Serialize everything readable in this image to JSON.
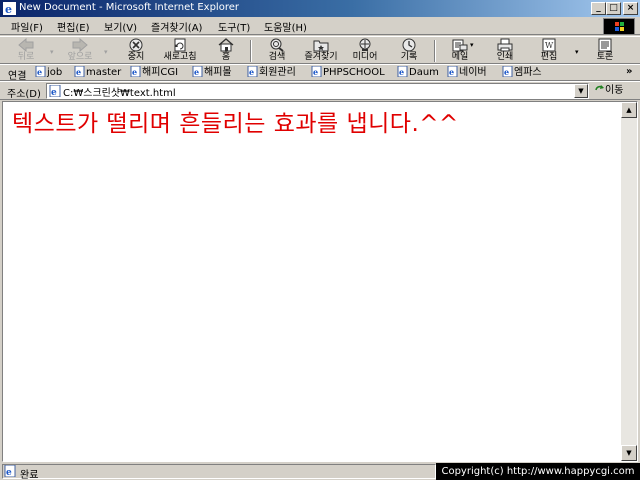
{
  "window": {
    "title": "New Document - Microsoft Internet Explorer"
  },
  "menu": [
    {
      "label": "파일(F)"
    },
    {
      "label": "편집(E)"
    },
    {
      "label": "보기(V)"
    },
    {
      "label": "즐겨찾기(A)"
    },
    {
      "label": "도구(T)"
    },
    {
      "label": "도움말(H)"
    }
  ],
  "toolbar": {
    "back": "뒤로",
    "forward": "앞으로",
    "stop": "중지",
    "refresh": "새로고침",
    "home": "홈",
    "search": "검색",
    "favorites": "즐겨찾기",
    "media": "미디어",
    "history": "기록",
    "mail": "메일",
    "print": "인쇄",
    "edit": "편집",
    "discuss": "토론"
  },
  "links": {
    "label": "연결",
    "items": [
      "job",
      "master",
      "해피CGI",
      "해피몰",
      "회원관리",
      "PHPSCHOOL",
      "Daum",
      "네이버",
      "엠파스"
    ]
  },
  "address": {
    "label": "주소(D)",
    "value": "C:₩스크린샷₩text.html",
    "go": "이동"
  },
  "page": {
    "text": "텍스트가 떨리며 흔들리는 효과를 냅니다.^^"
  },
  "status": {
    "text": "완료",
    "copyright": "Copyright(c) http://www.happycgi.com"
  }
}
